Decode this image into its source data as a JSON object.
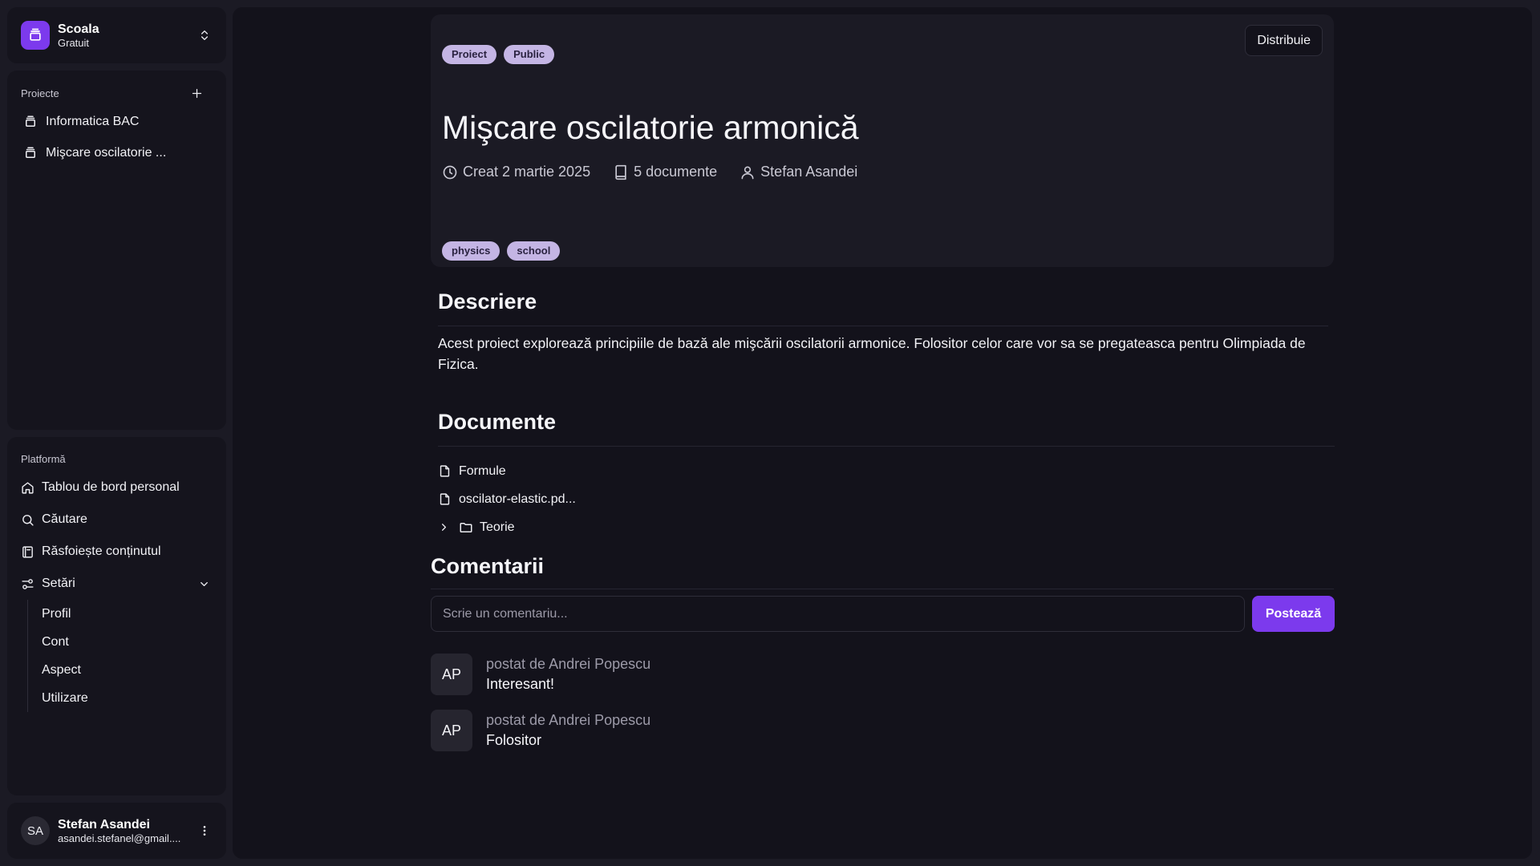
{
  "workspace": {
    "name": "Scoala",
    "plan": "Gratuit",
    "icon": "layers-icon",
    "accent": "#7c3aed"
  },
  "projects": {
    "title": "Proiecte",
    "items": [
      {
        "label": "Informatica BAC",
        "icon": "layers-icon"
      },
      {
        "label": "Mişcare oscilatorie ...",
        "icon": "layers-icon"
      }
    ]
  },
  "platform": {
    "title": "Platformă",
    "items": [
      {
        "label": "Tablou de bord personal",
        "icon": "home-icon"
      },
      {
        "label": "Căutare",
        "icon": "search-icon"
      },
      {
        "label": "Răsfoiește conținutul",
        "icon": "book-icon"
      },
      {
        "label": "Setări",
        "icon": "settings-icon"
      }
    ],
    "settings_sub": [
      "Profil",
      "Cont",
      "Aspect",
      "Utilizare"
    ]
  },
  "user": {
    "initials": "SA",
    "name": "Stefan Asandei",
    "email": "asandei.stefanel@gmail...."
  },
  "project": {
    "badges": [
      "Proiect",
      "Public"
    ],
    "share_label": "Distribuie",
    "title": "Mişcare oscilatorie armonică",
    "created": "Creat 2 martie 2025",
    "doc_count": "5 documente",
    "author": "Stefan Asandei",
    "tags": [
      "physics",
      "school"
    ]
  },
  "description": {
    "heading": "Descriere",
    "text": "Acest proiect explorează principiile de bază ale mişcării oscilatorii armonice. Folositor celor care vor sa se pregateasca pentru Olimpiada de Fizica."
  },
  "documents": {
    "heading": "Documente",
    "items": [
      {
        "label": "Formule",
        "icon": "file-icon"
      },
      {
        "label": "oscilator-elastic.pd...",
        "icon": "file-icon"
      },
      {
        "label": "Teorie",
        "icon": "folder-icon"
      }
    ]
  },
  "comments": {
    "heading": "Comentarii",
    "placeholder": "Scrie un comentariu...",
    "post_label": "Postează",
    "items": [
      {
        "initials": "AP",
        "author": "postat de Andrei Popescu",
        "text": "Interesant!"
      },
      {
        "initials": "AP",
        "author": "postat de Andrei Popescu",
        "text": "Folositor"
      }
    ]
  },
  "colors": {
    "background": "#1b1a24",
    "panel": "#15141d",
    "main": "#13121b",
    "chip": "#c4b5e4",
    "accent": "#7c3aed"
  }
}
